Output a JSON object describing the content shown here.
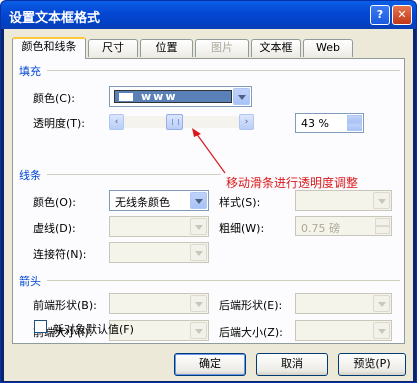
{
  "window": {
    "title": "设置文本框格式",
    "help_glyph": "?",
    "close_glyph": "✕"
  },
  "tabs": [
    {
      "label": "颜色和线条",
      "state": "active"
    },
    {
      "label": "尺寸",
      "state": "normal"
    },
    {
      "label": "位置",
      "state": "normal"
    },
    {
      "label": "图片",
      "state": "disabled"
    },
    {
      "label": "文本框",
      "state": "normal"
    },
    {
      "label": "Web",
      "state": "normal"
    }
  ],
  "fill": {
    "section_title": "填充",
    "color_label": "颜色(C):",
    "transparency_label": "透明度(T):",
    "transparency_value": "43 %",
    "transparency_fraction": 0.43
  },
  "annotation": "移动滑条进行透明度调整",
  "line": {
    "section_title": "线条",
    "color_label": "颜色(O):",
    "color_value": "无线条颜色",
    "dash_label": "虚线(D):",
    "connector_label": "连接符(N):",
    "style_label": "样式(S):",
    "weight_label": "粗细(W):",
    "weight_value": "0.75 磅"
  },
  "arrows": {
    "section_title": "箭头",
    "begin_style_label": "前端形状(B):",
    "begin_size_label": "前端大小(I):",
    "end_style_label": "后端形状(E):",
    "end_size_label": "后端大小(Z):"
  },
  "default_checkbox_label": "新对象默认值(F)",
  "buttons": {
    "ok": "确定",
    "cancel": "取消",
    "preview": "预览(P)"
  },
  "colors": {
    "titlebar": "#0548d4",
    "section_title": "#0046d5",
    "annotation": "#d9191c",
    "tab_highlight": "#ffc83c"
  }
}
